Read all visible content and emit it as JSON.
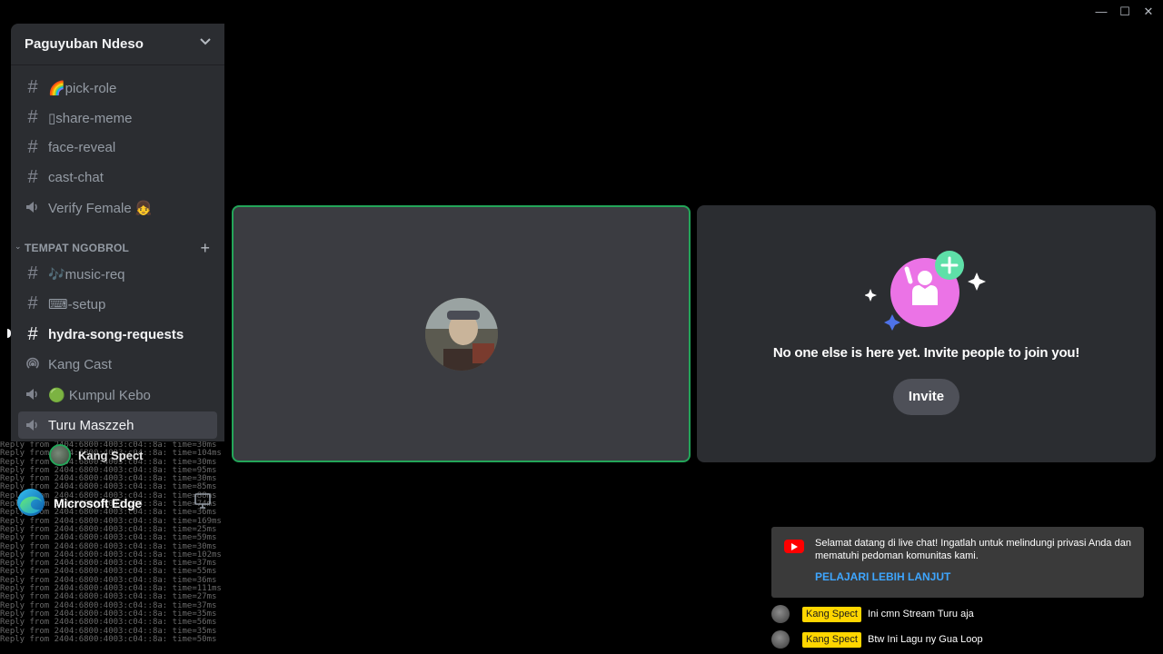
{
  "window": {
    "minimize": "—",
    "maximize": "☐",
    "close": "✕"
  },
  "server": {
    "name": "Paguyuban Ndeso"
  },
  "channels_top": [
    {
      "type": "text",
      "label": "🌈pick-role"
    },
    {
      "type": "text",
      "label": "▯share-meme"
    },
    {
      "type": "text",
      "label": "face-reveal"
    },
    {
      "type": "text",
      "label": "cast-chat"
    },
    {
      "type": "voice",
      "label": "Verify Female 👧"
    }
  ],
  "category": {
    "label": "TEMPAT NGOBROL"
  },
  "channels_bottom": [
    {
      "type": "text",
      "label": "🎶music-req"
    },
    {
      "type": "text",
      "label": "⌨-setup"
    },
    {
      "type": "text",
      "label": "hydra-song-requests",
      "unread": true
    },
    {
      "type": "stage",
      "label": "Kang Cast"
    },
    {
      "type": "voice",
      "label": "🟢 Kumpul Kebo"
    },
    {
      "type": "voice",
      "label": "Turu Maszzeh",
      "active": true
    }
  ],
  "voice_user": {
    "name": "Kang Spect"
  },
  "stream_app": {
    "name": "Microsoft Edge"
  },
  "terminal_lines": [
    "Reply from 2404:6800:4003:c04::8a: time=30ms",
    "Reply from 2404:6800:4003:c04::8a: time=104ms",
    "Reply from 2404:6800:4003:c04::8a: time=30ms",
    "Reply from 2404:6800:4003:c04::8a: time=95ms",
    "Reply from 2404:6800:4003:c04::8a: time=30ms",
    "Reply from 2404:6800:4003:c04::8a: time=85ms",
    "Reply from 2404:6800:4003:c04::8a: time=88ms",
    "Reply from 2404:6800:4003:c04::8a: time=74ms",
    "Reply from 2404:6800:4003:c04::8a: time=36ms",
    "Reply from 2404:6800:4003:c04::8a: time=169ms",
    "Reply from 2404:6800:4003:c04::8a: time=25ms",
    "Reply from 2404:6800:4003:c04::8a: time=59ms",
    "Reply from 2404:6800:4003:c04::8a: time=30ms",
    "Reply from 2404:6800:4003:c04::8a: time=102ms",
    "Reply from 2404:6800:4003:c04::8a: time=37ms",
    "Reply from 2404:6800:4003:c04::8a: time=55ms",
    "Reply from 2404:6800:4003:c04::8a: time=36ms",
    "Reply from 2404:6800:4003:c04::8a: time=111ms",
    "Reply from 2404:6800:4003:c04::8a: time=27ms",
    "Reply from 2404:6800:4003:c04::8a: time=37ms",
    "Reply from 2404:6800:4003:c04::8a: time=35ms",
    "Reply from 2404:6800:4003:c04::8a: time=56ms",
    "Reply from 2404:6800:4003:c04::8a: time=35ms",
    "Reply from 2404:6800:4003:c04::8a: time=50ms"
  ],
  "invite": {
    "message": "No one else is here yet. Invite people to join you!",
    "button": "Invite"
  },
  "live_chat": {
    "notice": "Selamat datang di live chat! Ingatlah untuk melindungi privasi Anda dan mematuhi pedoman komunitas kami.",
    "link": "PELAJARI LEBIH LANJUT",
    "messages": [
      {
        "author": "Kang Spect",
        "text": "Ini cmn Stream Turu aja"
      },
      {
        "author": "Kang Spect",
        "text": "Btw Ini Lagu ny Gua Loop"
      }
    ]
  },
  "colors": {
    "speaking_ring": "#23a559",
    "invite_accent": "#eb73e6",
    "add_badge": "#5ee0a8",
    "link_blue": "#3ea6ff",
    "member_badge": "#ffd600"
  }
}
